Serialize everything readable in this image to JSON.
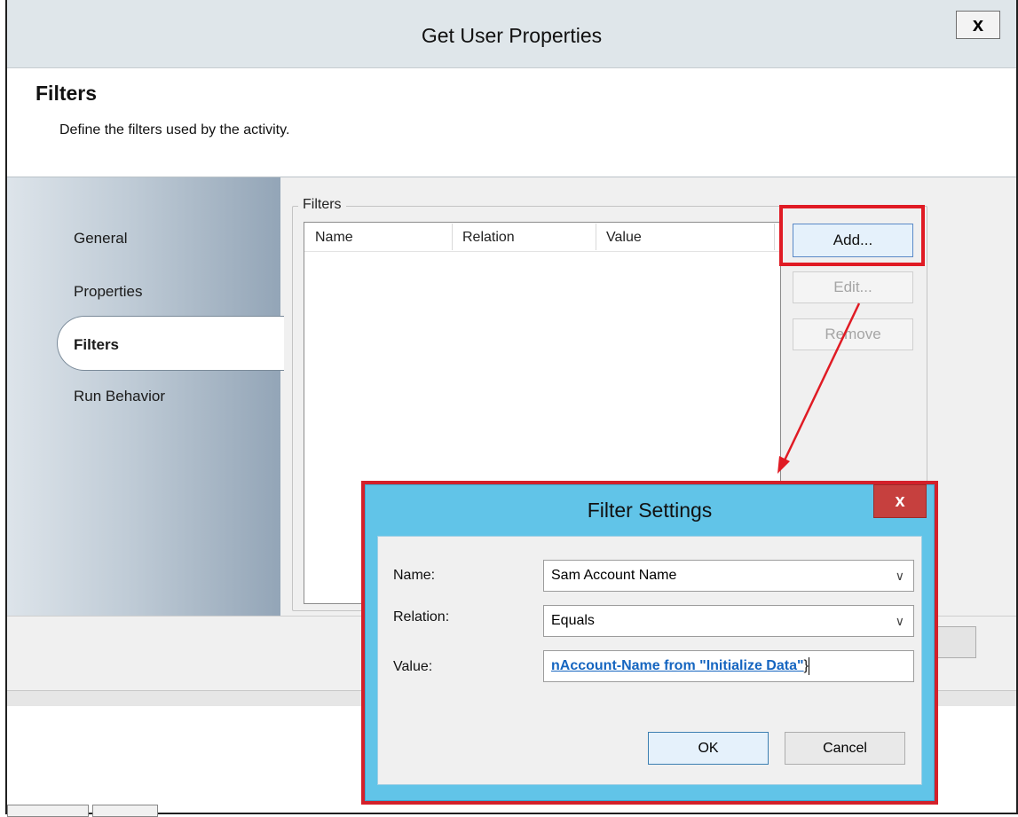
{
  "window": {
    "title": "Get User Properties",
    "close_glyph": "x"
  },
  "header": {
    "title": "Filters",
    "subtitle": "Define the filters used by the activity."
  },
  "nav": {
    "items": [
      {
        "label": "General"
      },
      {
        "label": "Properties"
      },
      {
        "label": "Filters",
        "selected": true
      },
      {
        "label": "Run Behavior"
      }
    ]
  },
  "filters": {
    "group_label": "Filters",
    "columns": [
      "Name",
      "Relation",
      "Value"
    ],
    "rows": [],
    "buttons": {
      "add": "Add...",
      "edit": "Edit...",
      "remove": "Remove"
    }
  },
  "dialog": {
    "title": "Filter Settings",
    "close_glyph": "x",
    "fields": {
      "name_label": "Name:",
      "name_value": "Sam Account Name",
      "relation_label": "Relation:",
      "relation_value": "Equals",
      "value_label": "Value:",
      "value_value": "nAccount-Name from \"Initialize Data\""
    },
    "ok": "OK",
    "cancel": "Cancel"
  },
  "colors": {
    "highlight": "#e01b24",
    "dialog_frame": "#61c4e8",
    "link": "#1565c0"
  },
  "icons": {
    "dropdown": "chevron-down-icon",
    "close": "close-icon"
  }
}
